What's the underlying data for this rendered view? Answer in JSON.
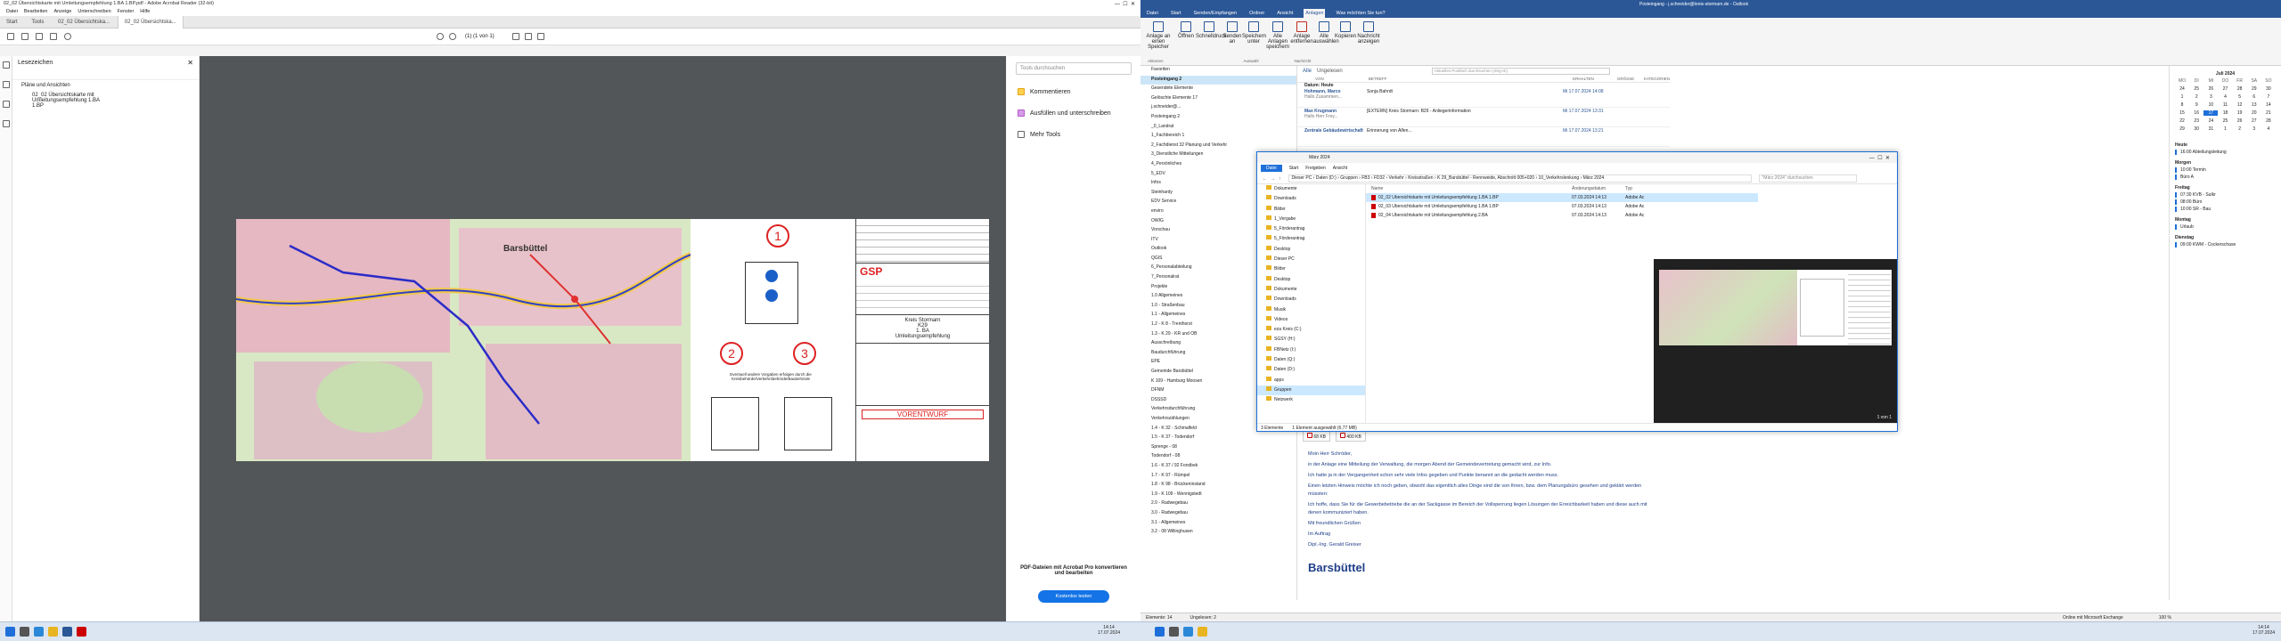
{
  "acrobat": {
    "title": "02_02 Übersichtskarte mit Umleitungsempfehlung 1.BA 1.BP.pdf - Adobe Acrobat Reader (32-bit)",
    "menu": [
      "Datei",
      "Bearbeiten",
      "Anzeige",
      "Unterschreiben",
      "Fenster",
      "Hilfe"
    ],
    "tabs": [
      "Start",
      "Tools",
      "02_02 Übersichtska...",
      "02_02 Übersichtska..."
    ],
    "page_indicator": "(1) (1 von 1)",
    "sidebar_title": "Lesezeichen",
    "bookmarks": [
      "Pläne und Ansichten",
      "02_02 Übersichtskarte mit Umleitungsempfehlung 1.BA 1.BP"
    ],
    "right_panel": {
      "search_placeholder": "Tools durchsuchen",
      "tools": [
        "Kommentieren",
        "Ausfüllen und unterschreiben",
        "Mehr Tools"
      ],
      "promo": "PDF-Dateien mit Acrobat Pro konvertieren und bearbeiten",
      "promo_button": "Kostenlos testen"
    },
    "sheet": {
      "map_label": "Barsbüttel",
      "circle1": "1",
      "circle2": "2",
      "circle3": "3",
      "note": "Eventuell andere Vorgaben erfolgen durch die Kreisbehörde/Verkehrsbehörde/Baubehörde",
      "company": "GSP",
      "kreis": "Kreis Stormarn",
      "k_label": "K29",
      "ba_label": "1. BA",
      "umleitung": "Umleitungsempfehlung",
      "vorentwurf": "VORENTWURF"
    }
  },
  "outlook": {
    "title": "Posteingang - j.schneider@kreis-stormarn.de - Outlook",
    "tabs": [
      "Datei",
      "Start",
      "Senden/Empfangen",
      "Ordner",
      "Ansicht",
      "Anlagen",
      "Was möchten Sie tun?"
    ],
    "ribbon": [
      "Anlage an einen Speicher",
      "Öffnen",
      "Schnelldruck",
      "Senden an",
      "Speichern unter",
      "Alle Anlagen speichern",
      "Anlage entfernen",
      "Alle auswählen",
      "Kopieren",
      "Nachricht anzeigen"
    ],
    "ribbon_groups": [
      "Aktionen",
      "Auswahl",
      "Nachricht"
    ],
    "nav_items": [
      "Favoriten",
      "Posteingang 2",
      "Gesendete Elemente",
      "Gelöschte Elemente 17",
      "j.schneider@...",
      "Posteingang 2",
      "_0_Landrat",
      "1_Fachbereich 1",
      "2_Fachdienst 32 Planung und Verkehr",
      "3_Dienstliche Mitteilungen",
      "4_Persönliches",
      "5_EDV",
      "Infos",
      "Steinhardy",
      "EDV Service",
      "enviro",
      "OWIG",
      "Vorschau",
      "ITV",
      "Outlook",
      "QGIS",
      "6_Personalabteilung",
      "7_Personalrat",
      "Projekte",
      "1.0 Allgemeines",
      "1.0 - Straßenbau",
      "1.1 - Allgemeines",
      "1.2 - K 8 - Trenthorst",
      "1.3 - K 29 - KR und OB",
      "Ausschreibung",
      "Baudurchführung",
      "EPE",
      "Gemeinde Barsbüttel",
      "K 109 - Hamburg Moosen",
      "DFNM",
      "DSSSD",
      "Verkehrsdurchführung",
      "Verkehrszählungen",
      "1.4 - K 32 - Schmalfeld",
      "1.5 - K 37 - Todendorf",
      "Sprenge - 08",
      "Todendorf - 08",
      "1.6 - K 37 / 92 Forstbek",
      "1.7 - K 97 - Rümpel",
      "1.8 - K 98 - Brückeninstand",
      "1.9 - K 109 - Wennigstedt",
      "2.0 - Radwegebau",
      "3.0 - Radwegebau",
      "3.1 - Allgemeines",
      "3.2 - 08 Willinghusen"
    ],
    "list_header": [
      "Alle",
      "Ungelesen"
    ],
    "search_placeholder": "Aktuelles Postfach durchsuchen (Strg+E)",
    "columns": [
      "VON",
      "BETREFF",
      "ERHALTEN",
      "GRÖSSE",
      "KATEGORIEN"
    ],
    "group": "Datum: Heute",
    "mails": [
      {
        "from": "Hohmann, Marco",
        "subject": "Sonja Bahrdt",
        "date": "Mi 17.07.2024 14:08",
        "size": "",
        "preview": "Hallo Zusammen..."
      },
      {
        "from": "Max Krugmann",
        "subject": "[EXTERN] Kreis Stormarn: B29 - Anliegerinformation",
        "date": "Mi 17.07.2024 13:31",
        "size": "",
        "preview": "Hallo Herr Frey..."
      },
      {
        "from": "Zentrale Gebäudewirtschaft",
        "subject": "Erinnerung von Alfen...",
        "date": "Mi 17.07.2024 13:21",
        "size": "",
        "preview": ""
      }
    ],
    "read": {
      "att1": "02_02 Übersichtskarte...",
      "att1_size": "68 KB",
      "att2": "...",
      "att2_size": "400 KB",
      "body": [
        "Moin Herr Schröder,",
        "in der Anlage eine Mitteilung der Verwaltung, die morgen Abend der Gemeindevertretung gemacht wird, zur Info.",
        "Ich hatte ja in der Vergangenheit schon sehr viele Infos gegeben und Punkte benannt an die gedacht werden muss.",
        "Einen letzten Hinweis möchte ich noch geben, obwohl das eigentlich alles Dinge sind die von Ihnen, bzw. dem Planungsbüro gesehen und geklärt werden müssten:",
        "Ich hoffe, dass Sie für die Gewerbebetriebe die an der Sackgasse im Bereich der Vollsperrung liegen Lösungen der Erreichbarkeit haben und diese auch mit denen kommuniziert haben.",
        "Mit freundlichen Grüßen",
        "Im Auftrag",
        "Dipl.-Ing. Gerald Greiser"
      ],
      "logo": "Barsbüttel"
    },
    "calendar": {
      "month": "Juli 2024",
      "weekdays": [
        "MO",
        "DI",
        "MI",
        "DO",
        "FR",
        "SA",
        "SO"
      ],
      "days": [
        "24",
        "25",
        "26",
        "27",
        "28",
        "29",
        "30",
        "1",
        "2",
        "3",
        "4",
        "5",
        "6",
        "7",
        "8",
        "9",
        "10",
        "11",
        "12",
        "13",
        "14",
        "15",
        "16",
        "17",
        "18",
        "19",
        "20",
        "21",
        "22",
        "23",
        "24",
        "25",
        "26",
        "27",
        "28",
        "29",
        "30",
        "31",
        "1",
        "2",
        "3",
        "4"
      ],
      "today": "17",
      "sections": [
        {
          "head": "Heute",
          "items": [
            "16:00 Abteilungsleitung"
          ]
        },
        {
          "head": "Morgen",
          "items": [
            "10:00 Termin",
            "Büro A"
          ]
        },
        {
          "head": "Freitag",
          "items": [
            "07:30 KVB - Sulkr",
            "08:00 Büro",
            "10:00 SR - Bau"
          ]
        },
        {
          "head": "Montag",
          "items": [
            "Urlaub"
          ]
        },
        {
          "head": "Dienstag",
          "items": [
            "09:00 KWM - Cockerschase"
          ]
        }
      ]
    },
    "status": [
      "Elemente: 14",
      "Ungelesen: 2",
      "Online mit Microsoft Exchange",
      "100 %"
    ]
  },
  "explorer": {
    "title": "März 2024",
    "tabs": [
      "Datei",
      "Start",
      "Freigeben",
      "Ansicht"
    ],
    "breadcrumb": [
      "Dieser PC",
      "Daten (D:)",
      "Gruppen",
      "FB3",
      "FD32",
      "Verkehr",
      "Kreisstraßen",
      "K 29_Barsbüttel - Rennweide, Abschnitt 005+020",
      "10_Verkehrslenkung",
      "März 2024"
    ],
    "search_placeholder": "\"März 2024\" durchsuchen",
    "nav": [
      "Dokumente",
      "Downloads",
      "Bilder",
      "1_Vergabe",
      "5_Förderantrag",
      "5_Förderantrag",
      "Desktop",
      "Dieser PC",
      "Bilder",
      "Desktop",
      "Dokumente",
      "Downloads",
      "Musik",
      "Videos",
      "eza Kreis (C:)",
      "SGSY (H:)",
      "FBNetz (I:)",
      "Daten (Q:)",
      "Daten (D:)",
      "apps",
      "Gruppen",
      "Netzwerk"
    ],
    "columns": [
      "Name",
      "Änderungsdatum",
      "Typ"
    ],
    "files": [
      {
        "name": "02_02 Übersichtskarte mit Umleitungsempfehlung 1.BA 1.BP",
        "date": "07.03.2024 14:13",
        "type": "Adobe Ac"
      },
      {
        "name": "02_03 Übersichtskarte mit Umleitungsempfehlung 1.BA 1.BP",
        "date": "07.03.2024 14:13",
        "type": "Adobe Ac"
      },
      {
        "name": "02_04 Übersichtskarte mit Umleitungsempfehlung 2.BA",
        "date": "07.03.2024 14:13",
        "type": "Adobe Ac"
      }
    ],
    "status": [
      "3 Elemente",
      "1 Element ausgewählt (6,77 MB)"
    ],
    "preview_page": "1 von 1"
  },
  "taskbar": {
    "time": "14:14",
    "date": "17.07.2024",
    "time2": "14:14",
    "date2": "17.07.2024"
  }
}
